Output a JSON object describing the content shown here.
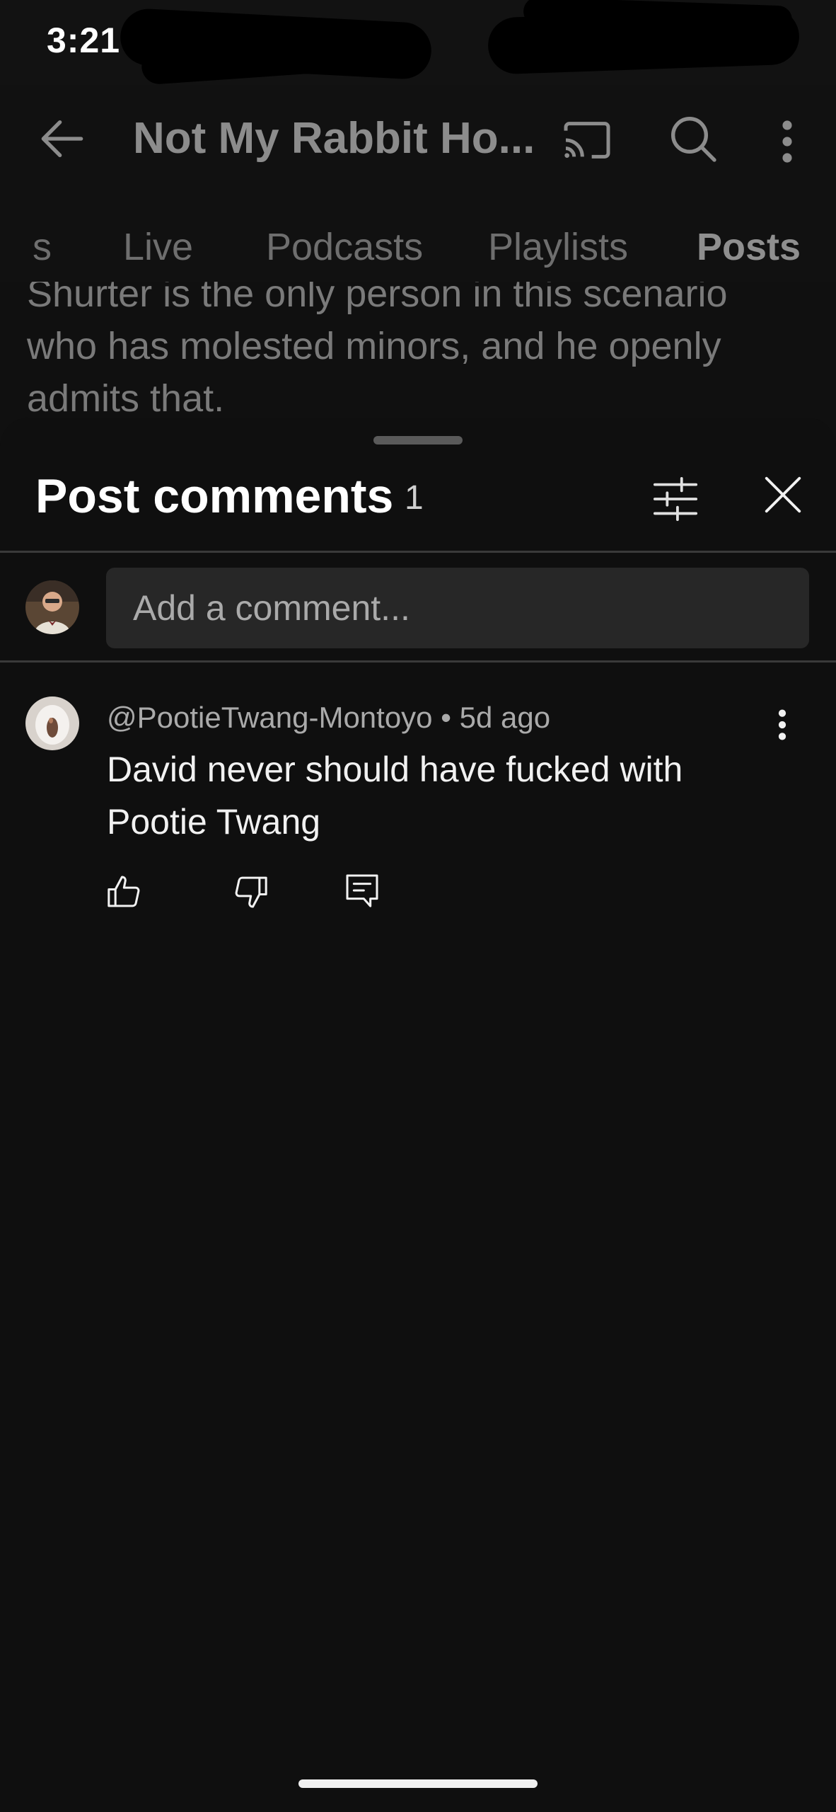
{
  "status_bar": {
    "time": "3:21"
  },
  "app_bar": {
    "title": "Not My Rabbit Ho...",
    "icons": [
      "back-arrow-icon",
      "cast-icon",
      "search-icon",
      "more-vert-icon"
    ]
  },
  "tabs": {
    "items": [
      {
        "label": "s"
      },
      {
        "label": "Live"
      },
      {
        "label": "Podcasts"
      },
      {
        "label": "Playlists"
      },
      {
        "label": "Posts",
        "active": true
      }
    ]
  },
  "post_preview": {
    "text": "Shurter is the only person in this scenario who has molested minors, and he openly admits that."
  },
  "sheet": {
    "title": "Post comments",
    "count": "1",
    "icons": [
      "filter-icon",
      "close-icon"
    ]
  },
  "comment_input": {
    "placeholder": "Add a comment..."
  },
  "comments": [
    {
      "meta": "@PootieTwang-Montoyo • 5d ago",
      "text": "David never should have fucked with Pootie Twang",
      "icons": [
        "thumbs-up-icon",
        "thumbs-down-icon",
        "reply-icon",
        "more-vert-icon"
      ]
    }
  ],
  "colors": {
    "background": "#0f0f0f",
    "input_background": "#272727",
    "primary_text": "#f1f1f1",
    "secondary_text": "#aaaaaa",
    "divider": "#3a3a3a"
  }
}
